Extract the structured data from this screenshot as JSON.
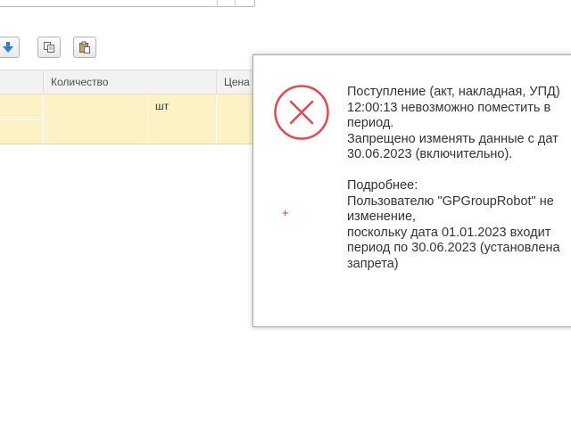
{
  "toolbar": {
    "buttons": [
      {
        "icon": "arrow-down-icon"
      },
      {
        "icon": "copy-icon"
      },
      {
        "icon": "paste-icon"
      }
    ]
  },
  "table": {
    "columns": [
      {
        "label": ""
      },
      {
        "label": "Количество"
      },
      {
        "label": "Цена"
      }
    ],
    "row": {
      "unit": "шт"
    }
  },
  "dialog": {
    "icon": "error-x-icon",
    "lines": [
      "Поступление (акт, накладная, УПД)",
      "12:00:13 невозможно поместить в",
      "период.",
      "Запрещено изменять данные с дат",
      "30.06.2023 (включительно).",
      "",
      "Подробнее:",
      "Пользователю \"GPGroupRobot\" не",
      "изменение,",
      "поскольку дата 01.01.2023 входит",
      "период по 30.06.2023 (установлена",
      "запрета)"
    ],
    "marker": "+"
  },
  "colors": {
    "row_highlight": "#fdf2c4",
    "header_bg": "#f2f2f2",
    "error_red": "#e8464e",
    "toolbar_blue": "#2a7fd4"
  }
}
